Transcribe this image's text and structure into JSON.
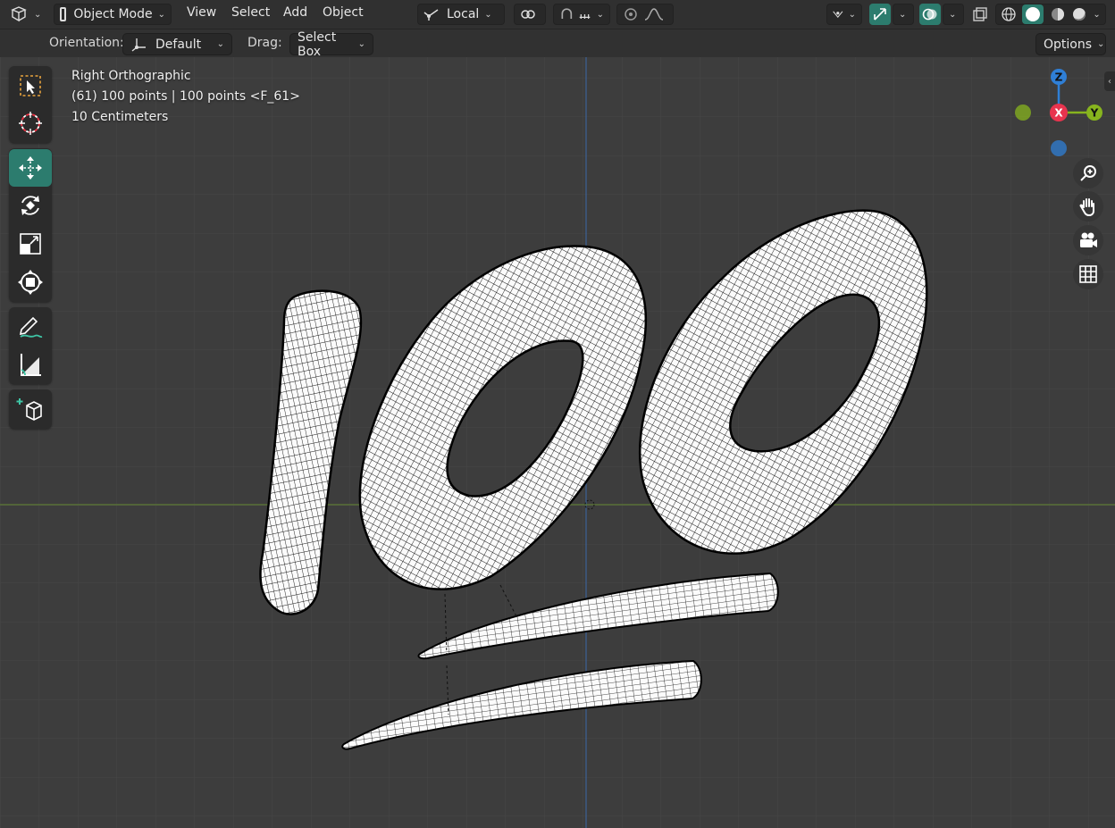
{
  "header": {
    "editor_type_icon": "3d-viewport-icon",
    "mode": "Object Mode",
    "menus": [
      "View",
      "Select",
      "Add",
      "Object"
    ],
    "transform_pivot": "Local",
    "shading_modes": [
      "wireframe",
      "solid",
      "material",
      "rendered"
    ],
    "accent_color": "#2c7c6e"
  },
  "tool_settings": {
    "orientation_label": "Orientation:",
    "orientation_value": "Default",
    "drag_label": "Drag:",
    "drag_value": "Select Box",
    "options_label": "Options"
  },
  "toolbar": {
    "tools": [
      "select-box",
      "cursor",
      "move",
      "rotate",
      "scale",
      "transform",
      "annotate",
      "measure",
      "add-cube"
    ],
    "active_tool": "move"
  },
  "viewport": {
    "view_name": "Right Orthographic",
    "object_info": "(61) 100 points | 100 points <F_61>",
    "grid_scale": "10 Centimeters",
    "background_color": "#3d3d3d",
    "grid_color": "#474747"
  },
  "gizmo": {
    "axes": [
      {
        "label": "Z",
        "color": "#2f7fd6"
      },
      {
        "label": "X",
        "color": "#e8344e"
      },
      {
        "label": "Y",
        "color": "#87b41e"
      }
    ]
  },
  "nav_buttons": [
    "zoom-icon",
    "hand-pan-icon",
    "camera-icon",
    "grid-toggle-icon"
  ]
}
